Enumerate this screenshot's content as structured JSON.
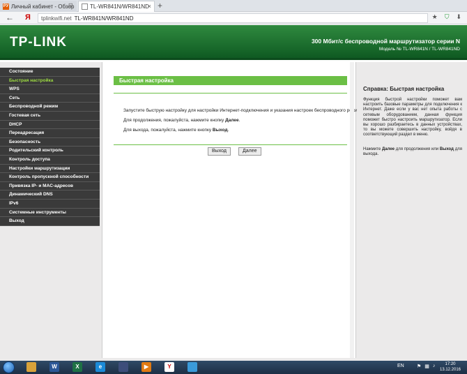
{
  "browser": {
    "tabs": [
      {
        "title": "Личный кабинет - Обзор",
        "favicon": "РУ"
      },
      {
        "title": "TL-WR841N/WR841ND"
      }
    ],
    "new_tab": "+",
    "nav_back": "←",
    "logo": "Я",
    "address_host": "tplinkwifi.net",
    "address_title": "TL-WR841N/WR841ND",
    "pin": "⊡",
    "close": "×"
  },
  "header": {
    "logo": "TP-LINK",
    "title": "300 Мбит/с беспроводной маршрутизатор серии N",
    "model": "Модель № TL-WR841N / TL-WR841ND"
  },
  "sidebar": {
    "items": [
      {
        "label": "Состояние"
      },
      {
        "label": "Быстрая настройка"
      },
      {
        "label": "WPS"
      },
      {
        "label": "Сеть"
      },
      {
        "label": "Беспроводной режим"
      },
      {
        "label": "Гостевая сеть"
      },
      {
        "label": "DHCP"
      },
      {
        "label": "Переадресация"
      },
      {
        "label": "Безопасность"
      },
      {
        "label": "Родительский контроль"
      },
      {
        "label": "Контроль доступа"
      },
      {
        "label": "Настройки маршрутизации"
      },
      {
        "label": "Контроль пропускной способности"
      },
      {
        "label": "Привязка IP- и MAC-адресов"
      },
      {
        "label": "Динамический DNS"
      },
      {
        "label": "IPv6"
      },
      {
        "label": "Системные инструменты"
      },
      {
        "label": "Выход"
      }
    ],
    "active_index": 1
  },
  "main": {
    "title": "Быстрая настройка",
    "p1": "Запустите быструю настройку для настройки Интернет-подключения и указания настроек беспроводного режима.",
    "p2_prefix": "Для продолжения, пожалуйста, нажмите кнопку ",
    "p2_bold": "Далее",
    "p2_suffix": ".",
    "p3_prefix": "Для выхода, пожалуйста, нажмите кнопку ",
    "p3_bold": "Выход",
    "p3_suffix": ".",
    "exit_button": "Выход",
    "next_button": "Далее"
  },
  "help": {
    "title": "Справка: Быстрая настройка",
    "text1": "Функция быстрой настройки поможет вам настроить базовые параметры для подключения к Интернет. Даже если у вас нет опыта работы с сетевым оборудованием, данная функция поможет быстро настроить маршрутизатор. Если вы хорошо разбираетесь в данных устройствах, то вы можете совершить настройку, войдя в соответствующий раздел в меню.",
    "text2_prefix": "Нажмите ",
    "text2_b1": "Далее",
    "text2_mid": " для продолжения или ",
    "text2_b2": "Выход",
    "text2_suffix": " для выхода."
  },
  "taskbar": {
    "lang": "EN",
    "time": "17:20",
    "date": "13.12.2016",
    "apps": [
      {
        "name": "folder",
        "color": "#d8a23a",
        "glyph": ""
      },
      {
        "name": "word",
        "color": "#2b5797",
        "glyph": "W"
      },
      {
        "name": "excel",
        "color": "#1e7145",
        "glyph": "X"
      },
      {
        "name": "ie",
        "color": "#1b8ad8",
        "glyph": "e"
      },
      {
        "name": "floppy",
        "color": "#3d4d7a",
        "glyph": ""
      },
      {
        "name": "media",
        "color": "#e07a12",
        "glyph": "▶"
      },
      {
        "name": "yandex",
        "color": "#ffffff",
        "glyph": "Y"
      },
      {
        "name": "tool",
        "color": "#3a9ad9",
        "glyph": ""
      }
    ]
  },
  "colors": {
    "brand_green": "#0f5a22",
    "accent_green": "#6bbf45",
    "active_menu": "#9ddc41"
  }
}
